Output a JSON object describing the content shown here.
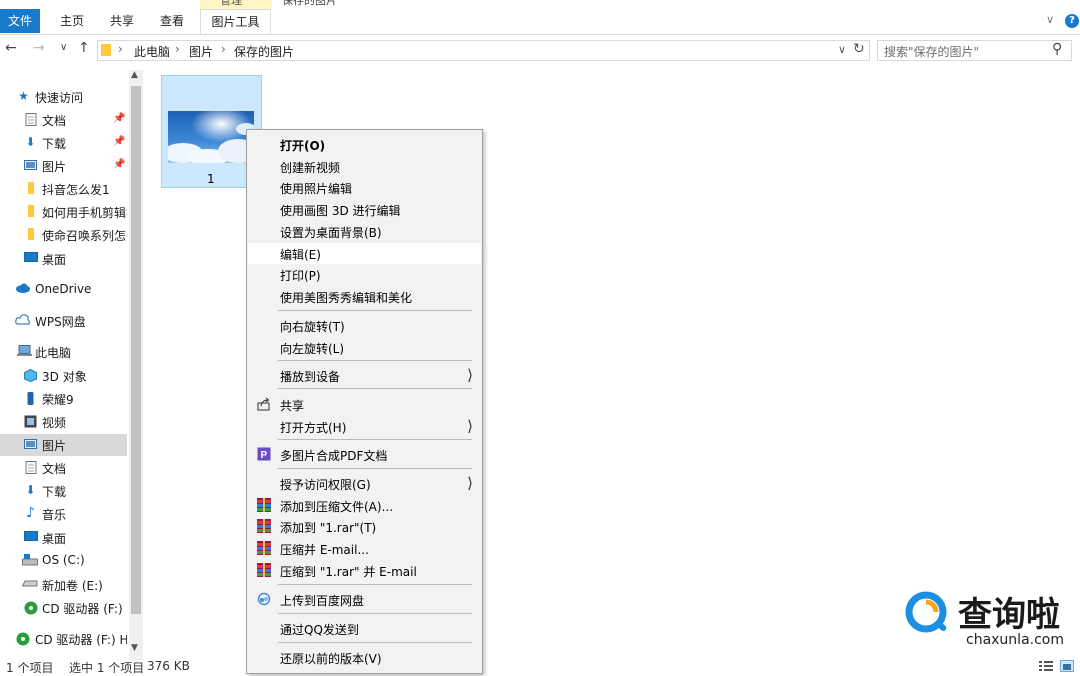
{
  "titlebar": {
    "manage_label": "管理",
    "title": "保存的图片"
  },
  "ribbon": {
    "tabs": [
      "文件",
      "主页",
      "共享",
      "查看",
      "图片工具"
    ],
    "help": "?"
  },
  "address": {
    "crumbs": [
      "此电脑",
      "图片",
      "保存的图片"
    ],
    "search_placeholder": "搜索\"保存的图片\""
  },
  "nav": {
    "quick_access": "快速访问",
    "items": [
      {
        "label": "文档",
        "icon": "document-icon",
        "pinned": true
      },
      {
        "label": "下载",
        "icon": "download-icon",
        "pinned": true
      },
      {
        "label": "图片",
        "icon": "pictures-icon",
        "pinned": true
      },
      {
        "label": "抖音怎么发1",
        "icon": "folder-icon"
      },
      {
        "label": "如何用手机剪辑视",
        "icon": "folder-icon"
      },
      {
        "label": "使命召唤系列怎么",
        "icon": "folder-icon"
      },
      {
        "label": "桌面",
        "icon": "desktop-icon"
      }
    ],
    "onedrive": "OneDrive",
    "wps": "WPS网盘",
    "this_pc": "此电脑",
    "pc_items": [
      {
        "label": "3D 对象",
        "icon": "3d-objects-icon"
      },
      {
        "label": "荣耀9",
        "icon": "phone-icon"
      },
      {
        "label": "视频",
        "icon": "video-icon"
      },
      {
        "label": "图片",
        "icon": "pictures-icon"
      },
      {
        "label": "文档",
        "icon": "document-icon"
      },
      {
        "label": "下载",
        "icon": "download-icon"
      },
      {
        "label": "音乐",
        "icon": "music-icon"
      },
      {
        "label": "桌面",
        "icon": "desktop-icon"
      },
      {
        "label": "OS (C:)",
        "icon": "drive-icon"
      },
      {
        "label": "新加卷 (E:)",
        "icon": "drive-icon"
      },
      {
        "label": "CD 驱动器 (F:) H",
        "icon": "cd-drive-icon"
      }
    ],
    "cd_root": "CD 驱动器 (F:) Hi"
  },
  "file": {
    "name": "1"
  },
  "context_menu": {
    "items": [
      {
        "label": "打开(O)",
        "bold": true
      },
      {
        "label": "创建新视频"
      },
      {
        "label": "使用照片编辑"
      },
      {
        "label": "使用画图 3D 进行编辑"
      },
      {
        "label": "设置为桌面背景(B)"
      },
      {
        "label": "编辑(E)",
        "hover": true
      },
      {
        "label": "打印(P)"
      },
      {
        "label": "使用美图秀秀编辑和美化"
      },
      {
        "label": "向右旋转(T)"
      },
      {
        "label": "向左旋转(L)"
      },
      {
        "label": "播放到设备",
        "submenu": true
      },
      {
        "label": "共享",
        "icon": "share-icon"
      },
      {
        "label": "打开方式(H)",
        "submenu": true
      },
      {
        "label": "多图片合成PDF文档",
        "icon": "pdf-icon"
      },
      {
        "label": "授予访问权限(G)",
        "submenu": true
      },
      {
        "label": "添加到压缩文件(A)...",
        "icon": "winrar-icon"
      },
      {
        "label": "添加到 \"1.rar\"(T)",
        "icon": "winrar-icon"
      },
      {
        "label": "压缩并 E-mail...",
        "icon": "winrar-icon"
      },
      {
        "label": "压缩到 \"1.rar\" 并 E-mail",
        "icon": "winrar-icon"
      },
      {
        "label": "上传到百度网盘",
        "icon": "baidu-cloud-icon"
      },
      {
        "label": "通过QQ发送到"
      },
      {
        "label": "还原以前的版本(V)"
      }
    ]
  },
  "status": {
    "count": "1 个项目",
    "selected": "选中 1 个项目",
    "size": "376 KB"
  },
  "watermark": {
    "main": "查询啦",
    "sub": "chaxunla.com"
  },
  "colors": {
    "accent": "#1979ca",
    "selection": "#cce8ff",
    "selection_border": "#99d1ff",
    "menu_bg": "#f2f2f2",
    "folder": "#ffc83d",
    "watermark_blue": "#1a8fe3"
  }
}
